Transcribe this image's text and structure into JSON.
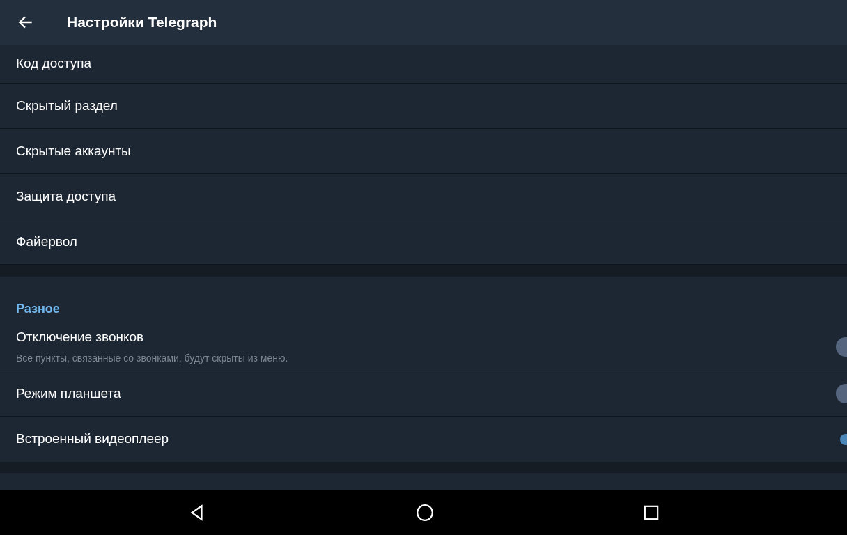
{
  "header": {
    "title": "Настройки Telegraph"
  },
  "items": [
    {
      "label": "Код доступа"
    },
    {
      "label": "Скрытый раздел"
    },
    {
      "label": "Скрытые аккаунты"
    },
    {
      "label": "Защита доступа"
    },
    {
      "label": "Файервол"
    }
  ],
  "section": {
    "title": "Разное",
    "toggles": [
      {
        "label": "Отключение звонков",
        "description": "Все пункты, связанные со звонками, будут скрыты из меню.",
        "on": false
      },
      {
        "label": "Режим планшета",
        "on": false
      },
      {
        "label": "Встроенный видеоплеер",
        "on": true
      }
    ]
  }
}
